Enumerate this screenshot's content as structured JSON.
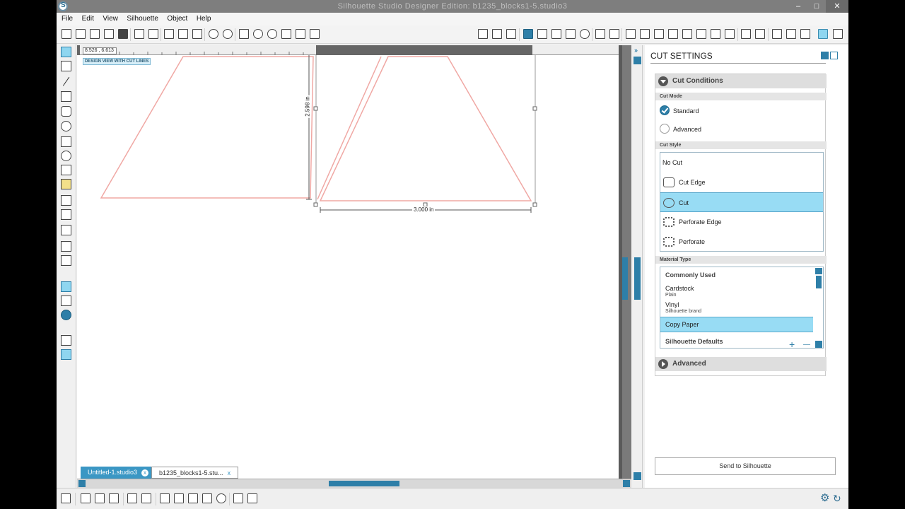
{
  "window": {
    "title": "Silhouette Studio Designer Edition: b1235_blocks1-5.studio3",
    "minimize": "–",
    "maximize": "□",
    "close": "✕"
  },
  "menu": [
    "File",
    "Edit",
    "View",
    "Silhouette",
    "Object",
    "Help"
  ],
  "canvas": {
    "coord_readout": "8.526 , 6.613",
    "view_label": "DESIGN VIEW WITH CUT LINES",
    "dim_height": "2.598 in",
    "dim_width": "3.000 in",
    "cut_line_color": "#f0a8a4"
  },
  "tabs": [
    {
      "label": "Untitled-1.studio3",
      "close": "x"
    },
    {
      "label": "b1235_blocks1-5.stu...",
      "close": "x"
    }
  ],
  "panel": {
    "title": "CUT SETTINGS",
    "cut_conditions": {
      "label": "Cut Conditions",
      "cut_mode_label": "Cut Mode",
      "modes": [
        {
          "label": "Standard",
          "checked": true
        },
        {
          "label": "Advanced",
          "checked": false
        }
      ],
      "cut_style_label": "Cut Style",
      "styles": [
        {
          "label": "No Cut",
          "icon": "no-cut-icon",
          "selected": false
        },
        {
          "label": "Cut Edge",
          "icon": "cut-edge-icon",
          "selected": false
        },
        {
          "label": "Cut",
          "icon": "cut-icon",
          "selected": true
        },
        {
          "label": "Perforate Edge",
          "icon": "perforate-edge-icon",
          "selected": false
        },
        {
          "label": "Perforate",
          "icon": "perforate-icon",
          "selected": false
        }
      ],
      "material_type_label": "Material Type",
      "materials": [
        {
          "label": "Commonly Used",
          "sub": "",
          "bold": true,
          "selected": false
        },
        {
          "label": "Cardstock",
          "sub": "Plain",
          "bold": false,
          "selected": false
        },
        {
          "label": "Vinyl",
          "sub": "Silhouette brand",
          "bold": false,
          "selected": false
        },
        {
          "label": "Copy Paper",
          "sub": "",
          "bold": false,
          "selected": true
        },
        {
          "label": "Silhouette Defaults",
          "sub": "",
          "bold": true,
          "selected": false
        }
      ],
      "add": "+",
      "remove": "—"
    },
    "advanced": {
      "label": "Advanced"
    },
    "send_button": "Send to Silhouette"
  },
  "colors": {
    "accent": "#2e7fa8",
    "selection": "#98dcf4",
    "tab_active": "#3b97c4"
  }
}
